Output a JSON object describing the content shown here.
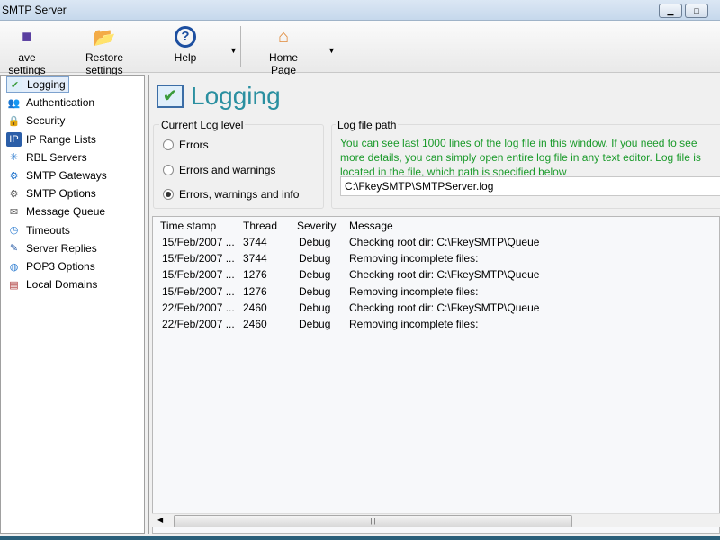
{
  "window": {
    "title": "SMTP Server"
  },
  "toolbar": {
    "save": "ave settings",
    "restore": "Restore settings",
    "help": "Help",
    "home": "Home Page"
  },
  "sidebar": {
    "items": [
      {
        "label": "Logging",
        "icon": "check-icon"
      },
      {
        "label": "Authentication",
        "icon": "users-icon"
      },
      {
        "label": "Security",
        "icon": "lock-icon"
      },
      {
        "label": "IP Range Lists",
        "icon": "ip-icon"
      },
      {
        "label": "RBL Servers",
        "icon": "network-icon"
      },
      {
        "label": "SMTP Gateways",
        "icon": "gateway-icon"
      },
      {
        "label": "SMTP Options",
        "icon": "options-icon"
      },
      {
        "label": "Message Queue",
        "icon": "queue-icon"
      },
      {
        "label": "Timeouts",
        "icon": "clock-icon"
      },
      {
        "label": "Server Replies",
        "icon": "reply-icon"
      },
      {
        "label": "POP3 Options",
        "icon": "globe-icon"
      },
      {
        "label": "Local Domains",
        "icon": "domain-icon"
      }
    ],
    "selected": "Logging"
  },
  "main": {
    "title": "Logging",
    "log_level": {
      "label": "Current Log level",
      "options": [
        "Errors",
        "Errors and warnings",
        "Errors, warnings and  info"
      ],
      "selected": 2
    },
    "log_path": {
      "label": "Log file path",
      "note": "You can see last 1000 lines of the log file in this window. If you need to see more details, you can simply open entire log file in any text editor. Log file is located in the file, which path is specified below",
      "value": "C:\\FkeySMTP\\SMTPServer.log"
    },
    "table": {
      "columns": [
        "Time stamp",
        "Thread",
        "Severity",
        "Message"
      ],
      "rows": [
        [
          "15/Feb/2007 ...",
          "3744",
          "Debug",
          "Checking root dir: C:\\FkeySMTP\\Queue"
        ],
        [
          "15/Feb/2007 ...",
          "3744",
          "Debug",
          "Removing incomplete files:"
        ],
        [
          "15/Feb/2007 ...",
          "1276",
          "Debug",
          "Checking root dir: C:\\FkeySMTP\\Queue"
        ],
        [
          "15/Feb/2007 ...",
          "1276",
          "Debug",
          "Removing incomplete files:"
        ],
        [
          "22/Feb/2007 ...",
          "2460",
          "Debug",
          "Checking root dir: C:\\FkeySMTP\\Queue"
        ],
        [
          "22/Feb/2007 ...",
          "2460",
          "Debug",
          "Removing incomplete files:"
        ]
      ]
    }
  }
}
